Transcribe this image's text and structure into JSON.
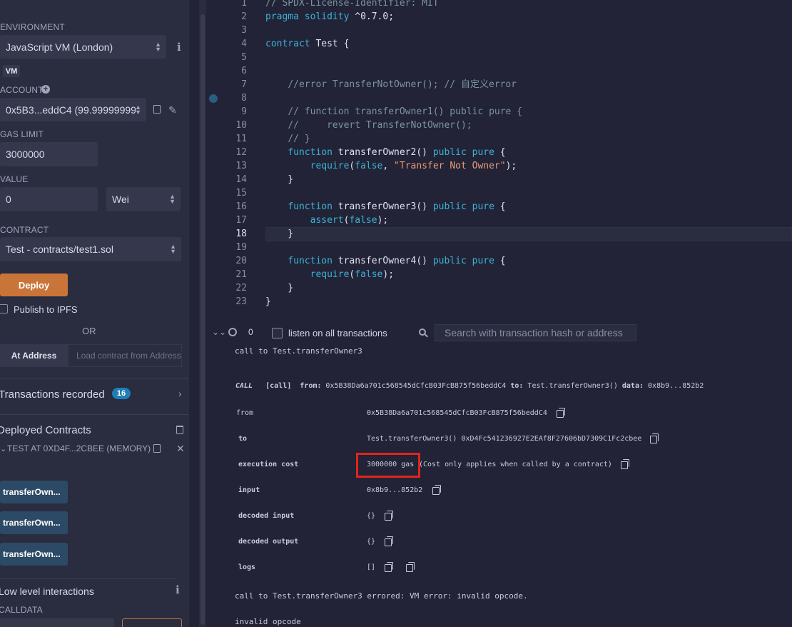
{
  "sidebar": {
    "environment_label": "ENVIRONMENT",
    "environment_value": "JavaScript VM (London)",
    "vm_badge": "VM",
    "account_label": "ACCOUNT",
    "account_value": "0x5B3...eddC4 (99.99999999",
    "gas_limit_label": "GAS LIMIT",
    "gas_limit_value": "3000000",
    "value_label": "VALUE",
    "value_amount": "0",
    "value_unit": "Wei",
    "contract_label": "CONTRACT",
    "contract_value": "Test - contracts/test1.sol",
    "deploy_label": "Deploy",
    "publish_label": "Publish to IPFS",
    "or_label": "OR",
    "at_address_label": "At Address",
    "load_contract_placeholder": "Load contract from Address",
    "transactions_recorded_label": "Transactions recorded",
    "transactions_count": "16",
    "deployed_contracts_label": "Deployed Contracts",
    "instance_title": "TEST AT 0XD4F...2CBEE (MEMORY)",
    "functions": [
      "transferOwn...",
      "transferOwn...",
      "transferOwn..."
    ],
    "low_level_label": "Low level interactions",
    "calldata_label": "CALLDATA"
  },
  "editor": {
    "active_line": 18,
    "lines": [
      {
        "n": "1",
        "code": "// SPDX-License-Identifier: MIT"
      },
      {
        "n": "2",
        "code": "pragma solidity ^0.7.0;"
      },
      {
        "n": "3",
        "code": ""
      },
      {
        "n": "4",
        "code": "contract Test {"
      },
      {
        "n": "5",
        "code": ""
      },
      {
        "n": "6",
        "code": ""
      },
      {
        "n": "7",
        "code": "    //error TransferNotOwner(); // 自定义error"
      },
      {
        "n": "8",
        "code": ""
      },
      {
        "n": "9",
        "code": "    // function transferOwner1() public pure {"
      },
      {
        "n": "10",
        "code": "    //     revert TransferNotOwner();"
      },
      {
        "n": "11",
        "code": "    // }"
      },
      {
        "n": "12",
        "code": "    function transferOwner2() public pure {"
      },
      {
        "n": "13",
        "code": "        require(false, \"Transfer Not Owner\");"
      },
      {
        "n": "14",
        "code": "    }"
      },
      {
        "n": "15",
        "code": ""
      },
      {
        "n": "16",
        "code": "    function transferOwner3() public pure {"
      },
      {
        "n": "17",
        "code": "        assert(false);"
      },
      {
        "n": "18",
        "code": "    }"
      },
      {
        "n": "19",
        "code": ""
      },
      {
        "n": "20",
        "code": "    function transferOwner4() public pure {"
      },
      {
        "n": "21",
        "code": "        require(false);"
      },
      {
        "n": "22",
        "code": "    }"
      },
      {
        "n": "23",
        "code": "}"
      }
    ]
  },
  "terminal": {
    "pending_count": "0",
    "listen_label": "listen on all transactions",
    "search_placeholder": "Search with transaction hash or address",
    "call_to_line": "call to Test.transferOwner3",
    "call_tag": "CALL",
    "call_kind": "[call]",
    "call_from_label": "from:",
    "call_from_value": "0x5B38Da6a701c568545dCfcB03FcB875f56beddC4",
    "call_to_label": "to:",
    "call_to_value": "Test.transferOwner3()",
    "call_data_label": "data:",
    "call_data_value": "0x8b9...852b2",
    "rows": [
      {
        "key": "from",
        "value": "0x5B38Da6a701c568545dCfcB03FcB875f56beddC4"
      },
      {
        "key": "to",
        "value": "Test.transferOwner3() 0xD4Fc541236927E2EAf8F27606bD7309C1Fc2cbee"
      },
      {
        "key": "execution cost",
        "value": "3000000 gas",
        "note": "(Cost only applies when called by a contract)"
      },
      {
        "key": "input",
        "value": "0x8b9...852b2"
      },
      {
        "key": "decoded input",
        "value": "{}"
      },
      {
        "key": "decoded output",
        "value": "{}"
      },
      {
        "key": "logs",
        "value": "[]"
      }
    ],
    "error_line": "call to Test.transferOwner3 errored: VM error: invalid opcode.",
    "invalid_line": "invalid opcode"
  },
  "colors": {
    "background": "#222336",
    "sidebar": "#2a2c3f",
    "keyword": "#3bb3d4",
    "string": "#e99b75",
    "comment": "#7b93a4",
    "deploy": "#c97539",
    "function_button": "#2c4a65",
    "highlight_box": "#e1251b"
  }
}
